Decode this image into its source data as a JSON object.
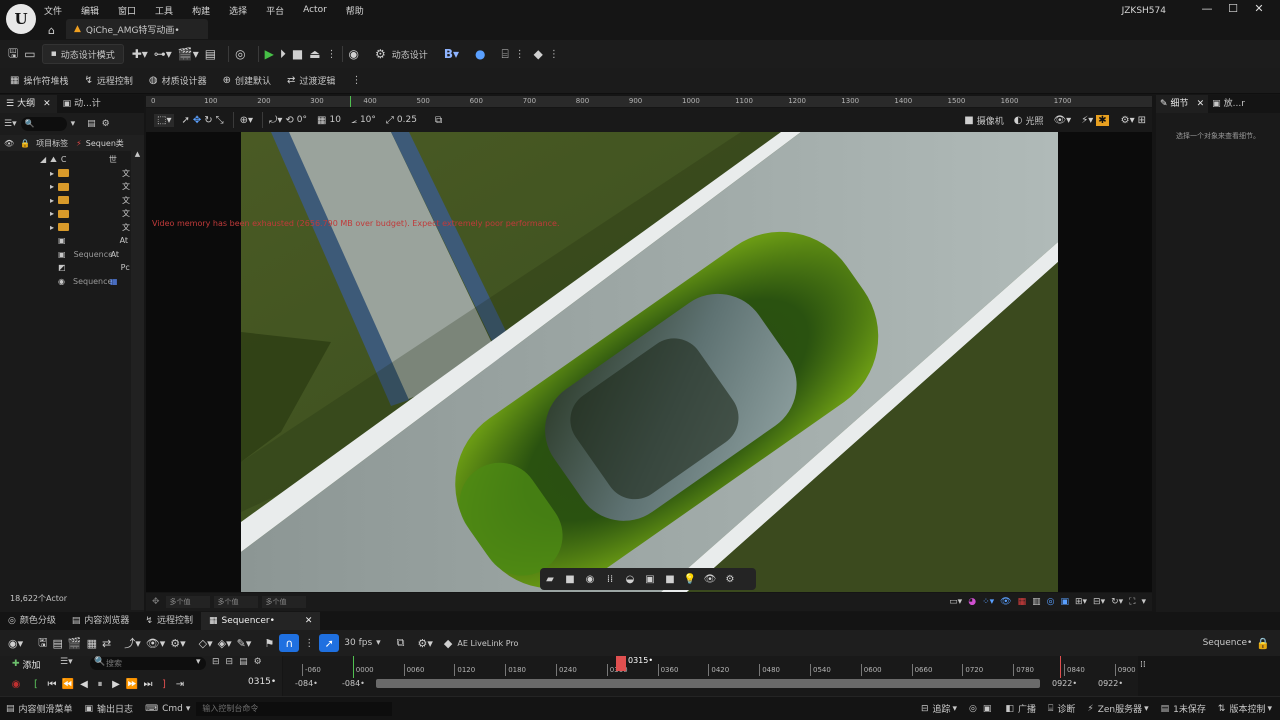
{
  "app": {
    "logo": "U",
    "menu": [
      "文件",
      "编辑",
      "窗口",
      "工具",
      "构建",
      "选择",
      "平台",
      "Actor",
      "帮助"
    ],
    "document_tab": "QiChe_AMG特写动画•",
    "user": "JZKSH574"
  },
  "toolbar": {
    "mode": "动态设计模式",
    "motion_design": "动态设计"
  },
  "subtoolbar": {
    "items": [
      "操作符堆栈",
      "远程控制",
      "材质设计器",
      "创建默认",
      "过渡逻辑"
    ]
  },
  "outliner": {
    "tabs": [
      "大纲",
      "动...计"
    ],
    "header": [
      "项目标签",
      "Sequen",
      "类"
    ],
    "rows": [
      {
        "name": "C",
        "type": "世"
      },
      {
        "name": "",
        "type": "文"
      },
      {
        "name": "",
        "type": "文"
      },
      {
        "name": "",
        "type": "文"
      },
      {
        "name": "",
        "type": "文"
      },
      {
        "name": "",
        "type": "文"
      },
      {
        "name": "",
        "type": "At"
      },
      {
        "name": "Sequence",
        "type": "At"
      },
      {
        "name": "",
        "type": "Pc"
      },
      {
        "name": "Sequence",
        "type": ""
      }
    ],
    "actor_count": "18,622个Actor"
  },
  "viewport": {
    "ruler_ticks": [
      "0",
      "100",
      "200",
      "300",
      "400",
      "500",
      "600",
      "700",
      "800",
      "900",
      "1000",
      "1100",
      "1200",
      "1300",
      "1400",
      "1500",
      "1600",
      "1700"
    ],
    "rotation_snap": "0°",
    "grid_snap": "10",
    "angle_snap": "10°",
    "scale_snap": "0.25",
    "camera_label": "摄像机",
    "lighting_label": "光照",
    "warning": "Video memory has been exhausted (2656.790 MB over budget). Expect extremely poor performance.",
    "multi_values": [
      "多个值",
      "多个值",
      "多个值"
    ]
  },
  "details": {
    "tabs": [
      "细节",
      "放...r"
    ],
    "empty_message": "选择一个对象来查看细节。"
  },
  "sequencer": {
    "tabs": [
      "颜色分级",
      "内容浏览器",
      "远程控制",
      "Sequencer•"
    ],
    "fps": "30 fps",
    "livelink": "AE LiveLink Pro",
    "sequence_name": "Sequence•",
    "add_label": "添加",
    "search_placeholder": "搜索",
    "current_frame": "0315•",
    "playhead_label": "0315•",
    "start_frames": [
      "-084•",
      "-084•"
    ],
    "end_frames": [
      "0922•",
      "0922•"
    ],
    "ticks": [
      "-060",
      "0000",
      "0060",
      "0120",
      "0180",
      "0240",
      "0300",
      "0360",
      "0420",
      "0480",
      "0540",
      "0600",
      "0660",
      "0720",
      "0780",
      "0840",
      "0900"
    ]
  },
  "statusbar": {
    "content_drawer": "内容侧滑菜单",
    "output_log": "输出日志",
    "cmd": "Cmd",
    "console_placeholder": "输入控制台命令",
    "trace": "追踪",
    "broadcast": "广播",
    "diagnostics": "诊断",
    "zen": "Zen服务器",
    "unsaved": "1未保存",
    "revision": "版本控制"
  },
  "colors": {
    "accent_blue": "#1f70e0",
    "play_green": "#47c047",
    "playhead_red": "#e05050",
    "warning_red": "#c03a3a",
    "folder_orange": "#d89a2a"
  }
}
